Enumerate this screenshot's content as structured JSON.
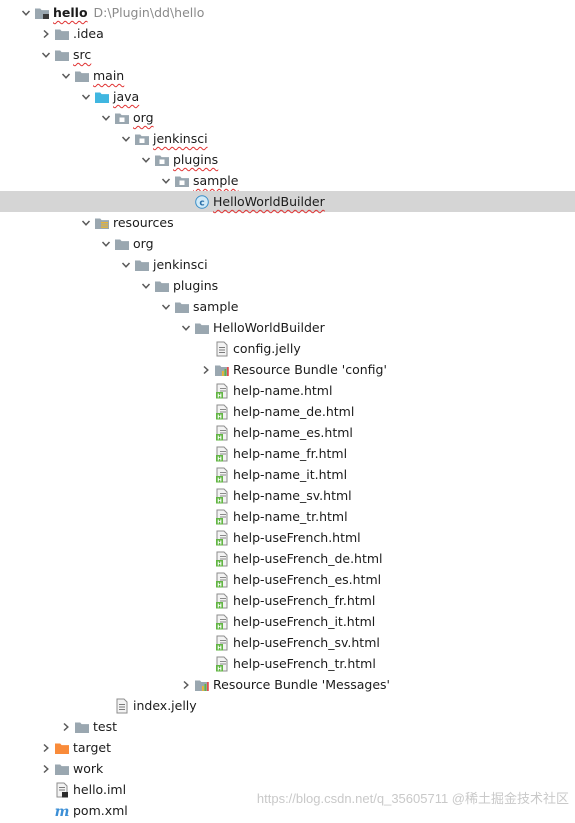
{
  "tree": [
    {
      "label": "hello",
      "path": "D:\\Plugin\\dd\\hello",
      "icon": "module-folder-icon",
      "arrow": "down",
      "depth": 0,
      "bold": true,
      "squig": true
    },
    {
      "label": ".idea",
      "icon": "folder-icon",
      "arrow": "right",
      "depth": 1
    },
    {
      "label": "src",
      "icon": "folder-icon",
      "arrow": "down",
      "depth": 1,
      "squig": true
    },
    {
      "label": "main",
      "icon": "folder-icon",
      "arrow": "down",
      "depth": 2,
      "squig": true
    },
    {
      "label": "java",
      "icon": "source-folder-icon",
      "arrow": "down",
      "depth": 3,
      "squig": true
    },
    {
      "label": "org",
      "icon": "package-icon",
      "arrow": "down",
      "depth": 4,
      "squig": true
    },
    {
      "label": "jenkinsci",
      "icon": "package-icon",
      "arrow": "down",
      "depth": 5,
      "squig": true
    },
    {
      "label": "plugins",
      "icon": "package-icon",
      "arrow": "down",
      "depth": 6,
      "squig": true
    },
    {
      "label": "sample",
      "icon": "package-icon",
      "arrow": "down",
      "depth": 7,
      "squig": true
    },
    {
      "label": "HelloWorldBuilder",
      "icon": "java-class-icon",
      "arrow": "none",
      "depth": 8,
      "selected": true,
      "squig": true
    },
    {
      "label": "resources",
      "icon": "resources-folder-icon",
      "arrow": "down",
      "depth": 3
    },
    {
      "label": "org",
      "icon": "folder-icon",
      "arrow": "down",
      "depth": 4
    },
    {
      "label": "jenkinsci",
      "icon": "folder-icon",
      "arrow": "down",
      "depth": 5
    },
    {
      "label": "plugins",
      "icon": "folder-icon",
      "arrow": "down",
      "depth": 6
    },
    {
      "label": "sample",
      "icon": "folder-icon",
      "arrow": "down",
      "depth": 7
    },
    {
      "label": "HelloWorldBuilder",
      "icon": "folder-icon",
      "arrow": "down",
      "depth": 8
    },
    {
      "label": "config.jelly",
      "icon": "text-file-icon",
      "arrow": "none",
      "depth": 9
    },
    {
      "label": "Resource Bundle 'config'",
      "icon": "resource-bundle-icon",
      "arrow": "right",
      "depth": 9
    },
    {
      "label": "help-name.html",
      "icon": "html-file-icon",
      "arrow": "none",
      "depth": 9
    },
    {
      "label": "help-name_de.html",
      "icon": "html-file-icon",
      "arrow": "none",
      "depth": 9
    },
    {
      "label": "help-name_es.html",
      "icon": "html-file-icon",
      "arrow": "none",
      "depth": 9
    },
    {
      "label": "help-name_fr.html",
      "icon": "html-file-icon",
      "arrow": "none",
      "depth": 9
    },
    {
      "label": "help-name_it.html",
      "icon": "html-file-icon",
      "arrow": "none",
      "depth": 9
    },
    {
      "label": "help-name_sv.html",
      "icon": "html-file-icon",
      "arrow": "none",
      "depth": 9
    },
    {
      "label": "help-name_tr.html",
      "icon": "html-file-icon",
      "arrow": "none",
      "depth": 9
    },
    {
      "label": "help-useFrench.html",
      "icon": "html-file-icon",
      "arrow": "none",
      "depth": 9
    },
    {
      "label": "help-useFrench_de.html",
      "icon": "html-file-icon",
      "arrow": "none",
      "depth": 9
    },
    {
      "label": "help-useFrench_es.html",
      "icon": "html-file-icon",
      "arrow": "none",
      "depth": 9
    },
    {
      "label": "help-useFrench_fr.html",
      "icon": "html-file-icon",
      "arrow": "none",
      "depth": 9
    },
    {
      "label": "help-useFrench_it.html",
      "icon": "html-file-icon",
      "arrow": "none",
      "depth": 9
    },
    {
      "label": "help-useFrench_sv.html",
      "icon": "html-file-icon",
      "arrow": "none",
      "depth": 9
    },
    {
      "label": "help-useFrench_tr.html",
      "icon": "html-file-icon",
      "arrow": "none",
      "depth": 9
    },
    {
      "label": "Resource Bundle 'Messages'",
      "icon": "resource-bundle-icon",
      "arrow": "right",
      "depth": 8
    },
    {
      "label": "index.jelly",
      "icon": "text-file-icon",
      "arrow": "none",
      "depth": 4
    },
    {
      "label": "test",
      "icon": "folder-icon",
      "arrow": "right",
      "depth": 2
    },
    {
      "label": "target",
      "icon": "excluded-folder-icon",
      "arrow": "right",
      "depth": 1
    },
    {
      "label": "work",
      "icon": "folder-icon",
      "arrow": "right",
      "depth": 1
    },
    {
      "label": "hello.iml",
      "icon": "iml-file-icon",
      "arrow": "none",
      "depth": 1
    },
    {
      "label": "pom.xml",
      "icon": "maven-icon",
      "arrow": "none",
      "depth": 1
    }
  ],
  "colors": {
    "folder": "#9aa7b0",
    "source_folder": "#40b6e0",
    "excluded_folder": "#f98b3a",
    "selection": "#d5d5d5",
    "html_badge": "#62b543",
    "maven": "#3c8fd6"
  },
  "watermark": "https://blog.csdn.net/q_35605711 @稀土掘金技术社区"
}
